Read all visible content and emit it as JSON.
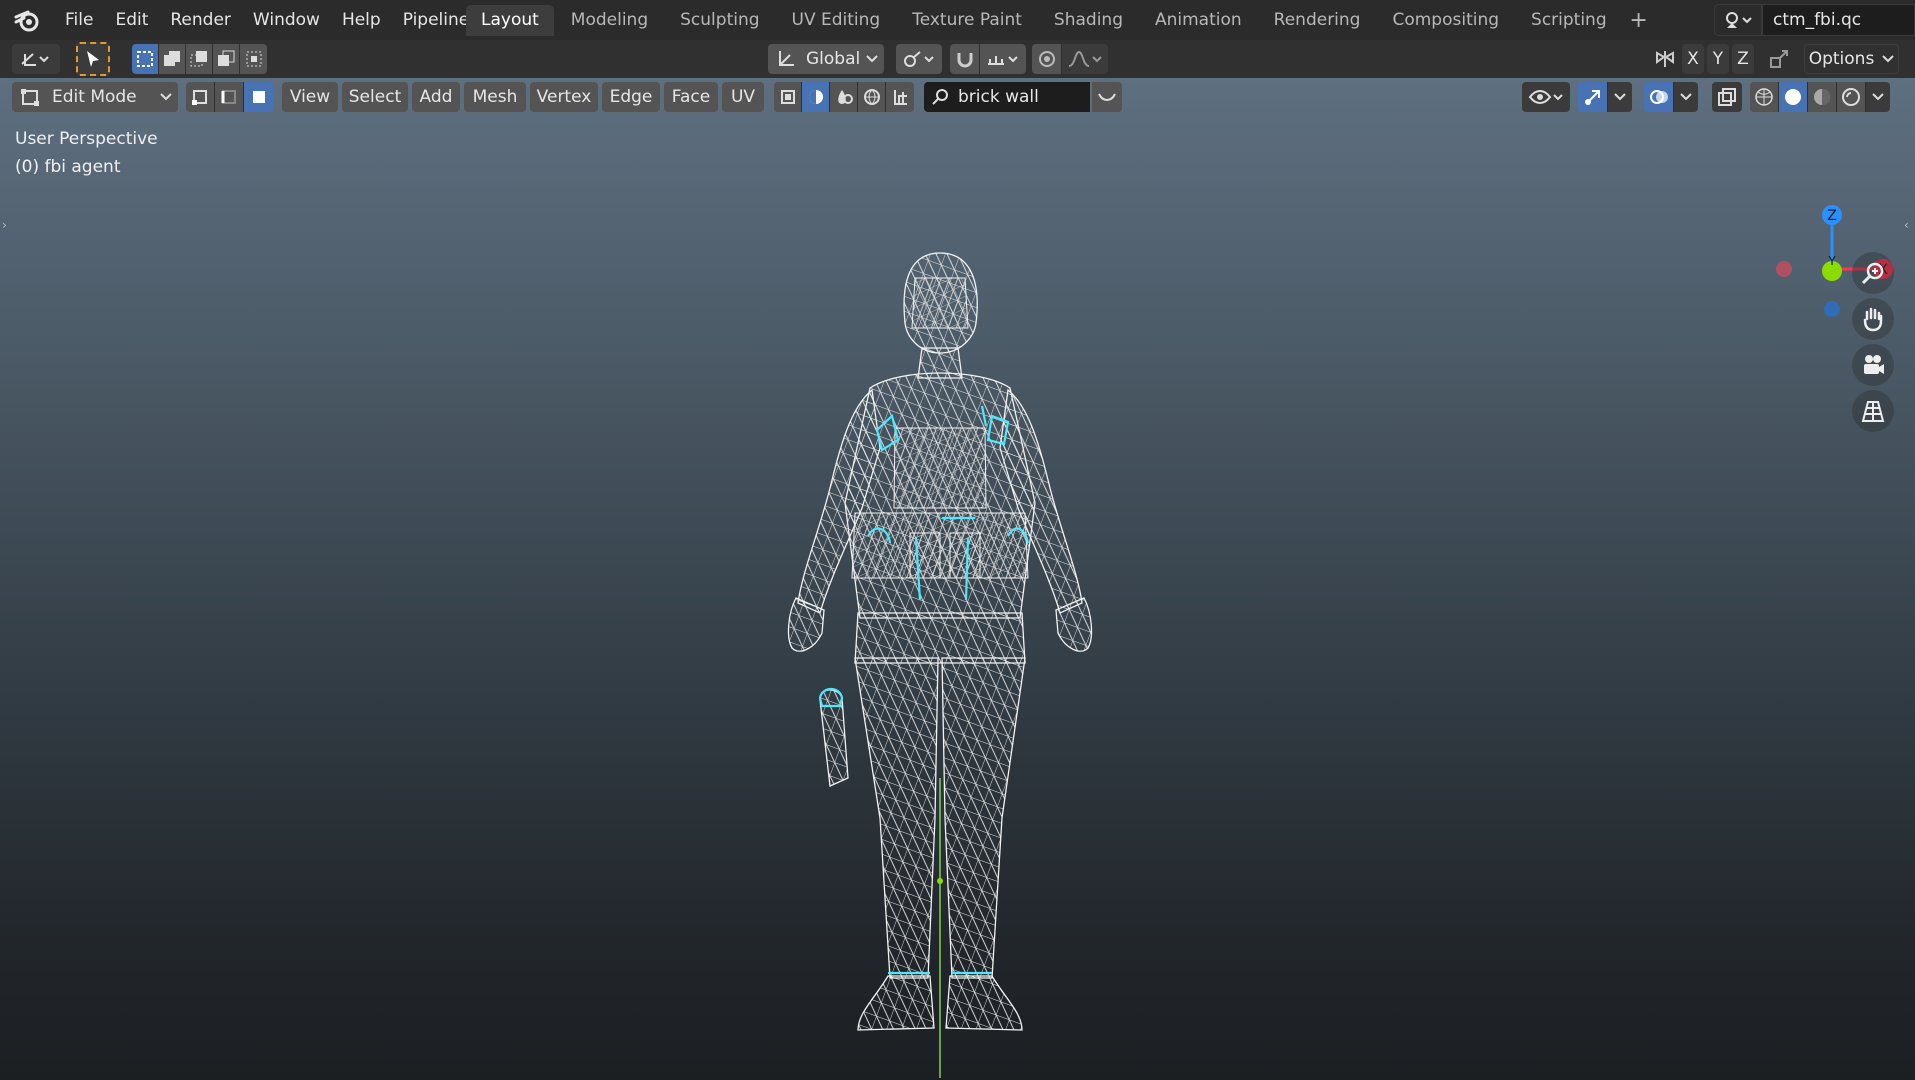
{
  "menu": [
    "File",
    "Edit",
    "Render",
    "Window",
    "Help",
    "Pipeline"
  ],
  "workspaces": {
    "active": "Layout",
    "tabs": [
      "Layout",
      "Modeling",
      "Sculpting",
      "UV Editing",
      "Texture Paint",
      "Shading",
      "Animation",
      "Rendering",
      "Compositing",
      "Scripting"
    ],
    "add_label": "+"
  },
  "scene": {
    "name": "ctm_fbi.qc"
  },
  "toolbar": {
    "transform_orientation": "Global",
    "axis_x": "X",
    "axis_y": "Y",
    "axis_z": "Z",
    "options_label": "Options"
  },
  "header": {
    "mode": "Edit Mode",
    "menus": [
      "View",
      "Select",
      "Add",
      "Mesh",
      "Vertex",
      "Edge",
      "Face",
      "UV"
    ],
    "search_value": "brick wall"
  },
  "viewport": {
    "perspective_label": "User Perspective",
    "object_label": "(0) fbi agent"
  },
  "gizmo": {
    "z": "Z",
    "y": "Y",
    "x": "X"
  },
  "colors": {
    "accent": "#4772b3",
    "axis_x": "#ff3352",
    "axis_y": "#8bdc00",
    "axis_z": "#2890ff",
    "selection": "#4ce8ff",
    "wire": "#e8e8e8"
  }
}
